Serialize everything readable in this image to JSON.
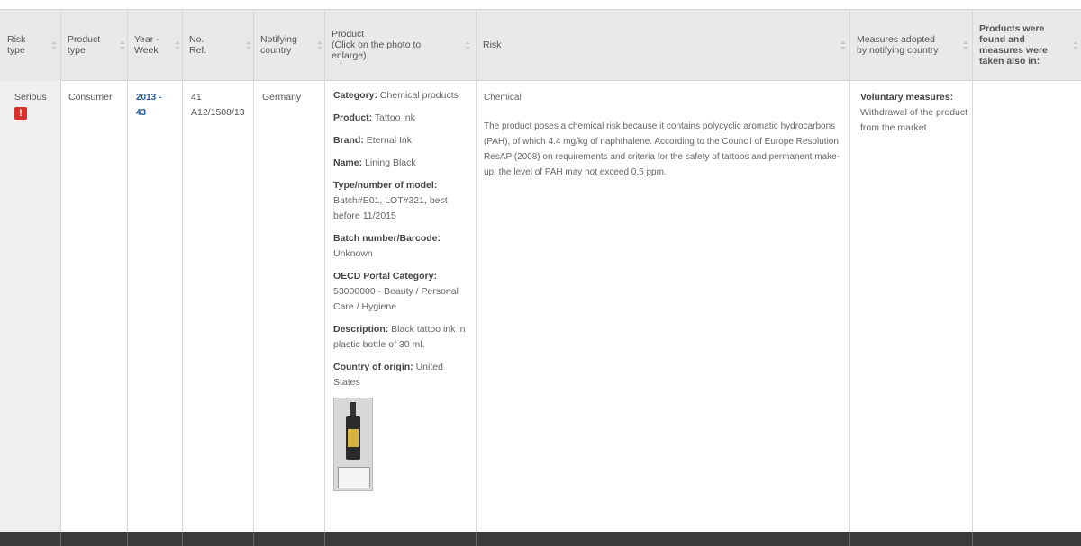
{
  "headers": [
    {
      "label": "Risk\ntype"
    },
    {
      "label": "Product\ntype"
    },
    {
      "label": "Year -\nWeek"
    },
    {
      "label": "No.\nRef."
    },
    {
      "label": "Notifying\ncountry"
    },
    {
      "label": "Product\n(Click on the photo to\nenlarge)"
    },
    {
      "label": "Risk"
    },
    {
      "label": "Measures adopted\nby notifying country"
    },
    {
      "label": "Products were\nfound and\nmeasures were\ntaken also in:"
    }
  ],
  "row": {
    "risk_type": "Serious",
    "risk_icon": "!",
    "product_type": "Consumer",
    "year_week_1": "2013 -",
    "year_week_2": "43",
    "ref_no": "41",
    "ref_code": "A12/1508/13",
    "country": "Germany",
    "product_details": [
      {
        "label": "Category:",
        "value": " Chemical products"
      },
      {
        "label": "Product:",
        "value": " Tattoo ink"
      },
      {
        "label": "Brand:",
        "value": " Eternal Ink"
      },
      {
        "label": "Name:",
        "value": " Lining Black"
      },
      {
        "label": "Type/number of model:",
        "value": " Batch#E01, LOT#321, best before 11/2015"
      },
      {
        "label": "Batch number/Barcode:",
        "value": " Unknown"
      },
      {
        "label": "OECD Portal Category:",
        "value": " 53000000 - Beauty / Personal Care / Hygiene"
      },
      {
        "label": "Description:",
        "value": " Black tattoo ink in plastic bottle of 30 ml."
      },
      {
        "label": "Country of origin:",
        "value": " United States"
      }
    ],
    "risk_category": "Chemical",
    "risk_description": "The product poses a chemical risk because it contains polycyclic aromatic hydrocarbons (PAH), of which 4.4 mg/kg of naphthalene. According to the Council of Europe Resolution ResAP (2008) on requirements and criteria for the safety of tattoos and permanent make-up, the level of PAH may not exceed 0.5 ppm.",
    "measures_title": "Voluntary measures:",
    "measures_text": "Withdrawal of the product from the market"
  },
  "icons": {
    "warning": "warning-icon",
    "sort": "sort-icon"
  },
  "colors": {
    "header_bg": "#e9e9e9",
    "footer_bg": "#3b3b3b",
    "link": "#1f5aa8",
    "warning": "#d9302c"
  }
}
